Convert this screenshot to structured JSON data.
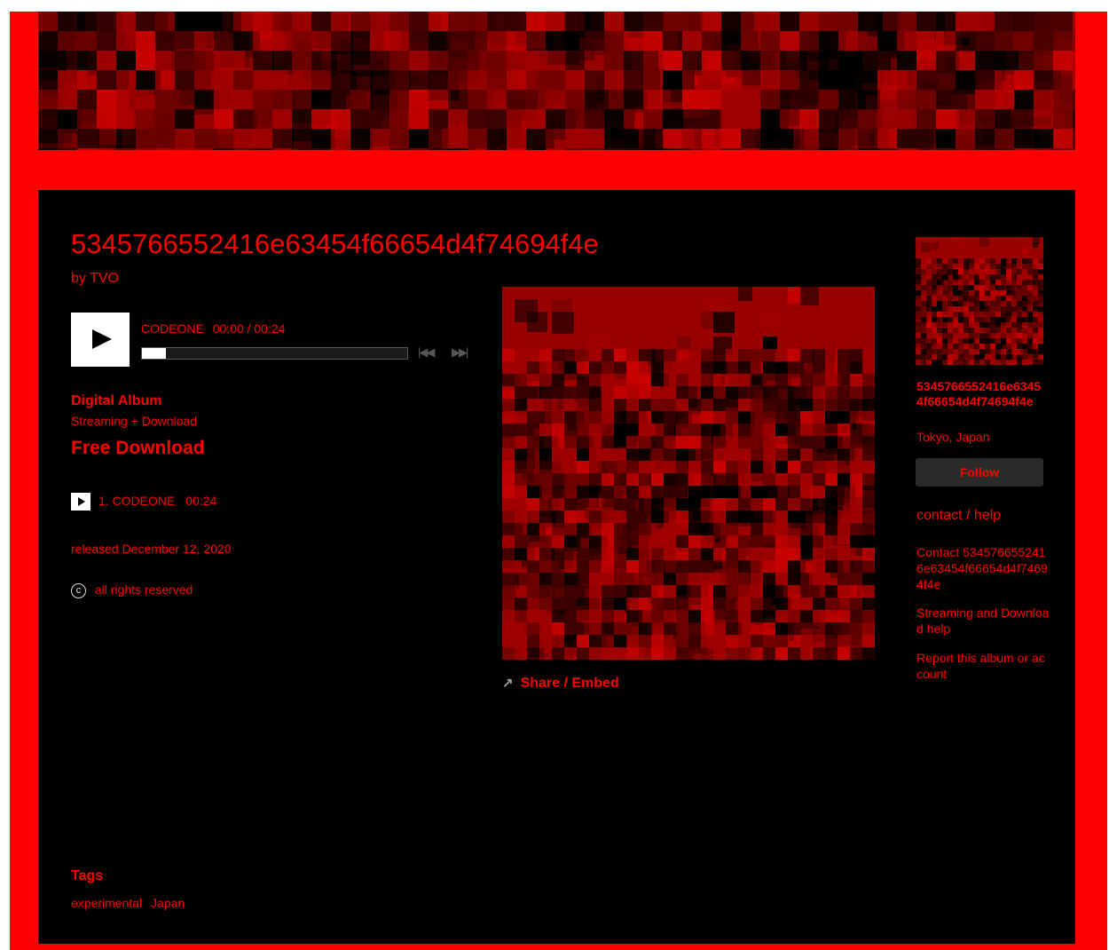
{
  "album": {
    "title": "5345766552416e63454f66654d4f74694f4e",
    "by_prefix": "by",
    "artist": "TVO"
  },
  "player": {
    "track_name": "CODEONE",
    "time": "00:00 / 00:24",
    "progress": 0.0,
    "prev_glyph": "|◀◀",
    "next_glyph": "▶▶|"
  },
  "format": {
    "title": "Digital Album",
    "subtitle": "Streaming + Download",
    "download_label": "Free Download"
  },
  "tracks": [
    {
      "label": "1. CODEONE",
      "duration": "00:24"
    }
  ],
  "released": "released December 12, 2020",
  "rights": {
    "symbol": "c",
    "text": "all rights reserved"
  },
  "tags": {
    "heading": "Tags",
    "items": [
      "experimental",
      "Japan"
    ]
  },
  "share": {
    "label": "Share / Embed",
    "icon": "share-icon"
  },
  "sidebar": {
    "name": "5345766552416e63454f66654d4f74694f4e",
    "location": "Tokyo, Japan",
    "follow_label": "Follow",
    "contact_heading": "contact / help",
    "contact_link": "Contact 5345766552416e63454f66654d4f74694f4e",
    "help_link": "Streaming and Download help",
    "report_link": "Report this album or account"
  },
  "colors": {
    "accent": "#ff0000",
    "background": "#000000",
    "frame": "#ff0000"
  }
}
